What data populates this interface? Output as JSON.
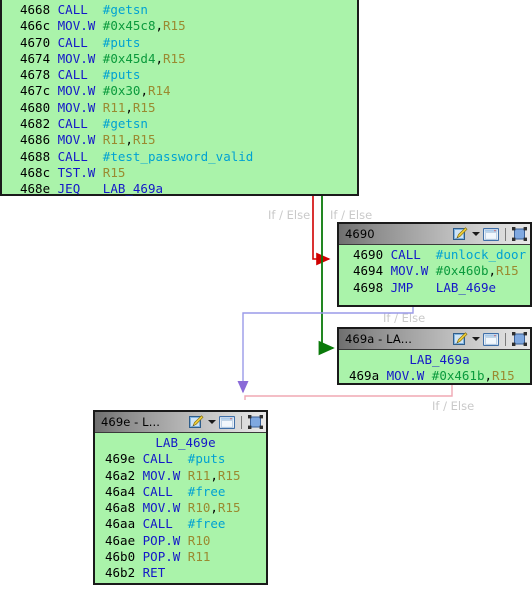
{
  "app": {
    "view": "function-graph",
    "background": "#ffffff"
  },
  "colors": {
    "block_body": "#aaf3aa",
    "block_border": "#1a1a1a",
    "mnemonic": "#1418c8",
    "register": "#9a8a30",
    "constant": "#0a9a3c",
    "symbol": "#00a2d2",
    "edge_true": "#008000",
    "edge_false": "#d00000",
    "edge_unconditional": "#9a9ae8",
    "edge_fallthrough_pink": "#f0a8b4",
    "edge_label_text": "#c9c9c9"
  },
  "blocks": [
    {
      "id": "entry",
      "title": null,
      "has_titlebar": false,
      "listing": [
        {
          "addr": "4668",
          "mnem": "CALL",
          "ops": [
            {
              "t": "sym",
              "v": "#getsn"
            }
          ]
        },
        {
          "addr": "466c",
          "mnem": "MOV.W",
          "ops": [
            {
              "t": "const",
              "v": "#0x45c8"
            },
            {
              "t": "punct",
              "v": ","
            },
            {
              "t": "reg",
              "v": "R15"
            }
          ]
        },
        {
          "addr": "4670",
          "mnem": "CALL",
          "ops": [
            {
              "t": "sym",
              "v": "#puts"
            }
          ]
        },
        {
          "addr": "4674",
          "mnem": "MOV.W",
          "ops": [
            {
              "t": "const",
              "v": "#0x45d4"
            },
            {
              "t": "punct",
              "v": ","
            },
            {
              "t": "reg",
              "v": "R15"
            }
          ]
        },
        {
          "addr": "4678",
          "mnem": "CALL",
          "ops": [
            {
              "t": "sym",
              "v": "#puts"
            }
          ]
        },
        {
          "addr": "467c",
          "mnem": "MOV.W",
          "ops": [
            {
              "t": "const",
              "v": "#0x30"
            },
            {
              "t": "punct",
              "v": ","
            },
            {
              "t": "reg",
              "v": "R14"
            }
          ]
        },
        {
          "addr": "4680",
          "mnem": "MOV.W",
          "ops": [
            {
              "t": "reg",
              "v": "R11"
            },
            {
              "t": "punct",
              "v": ","
            },
            {
              "t": "reg",
              "v": "R15"
            }
          ]
        },
        {
          "addr": "4682",
          "mnem": "CALL",
          "ops": [
            {
              "t": "sym",
              "v": "#getsn"
            }
          ]
        },
        {
          "addr": "4686",
          "mnem": "MOV.W",
          "ops": [
            {
              "t": "reg",
              "v": "R11"
            },
            {
              "t": "punct",
              "v": ","
            },
            {
              "t": "reg",
              "v": "R15"
            }
          ]
        },
        {
          "addr": "4688",
          "mnem": "CALL",
          "ops": [
            {
              "t": "sym",
              "v": "#test_password_valid"
            }
          ]
        },
        {
          "addr": "468c",
          "mnem": "TST.W",
          "ops": [
            {
              "t": "reg",
              "v": "R15"
            }
          ]
        },
        {
          "addr": "468e",
          "mnem": "JEQ",
          "ops": [
            {
              "t": "lbl",
              "v": "LAB_469a"
            }
          ]
        }
      ]
    },
    {
      "id": "b4690",
      "title": "4690",
      "has_titlebar": true,
      "listing": [
        {
          "addr": "4690",
          "mnem": "CALL",
          "ops": [
            {
              "t": "sym",
              "v": "#unlock_door"
            }
          ]
        },
        {
          "addr": "4694",
          "mnem": "MOV.W",
          "ops": [
            {
              "t": "const",
              "v": "#0x460b"
            },
            {
              "t": "punct",
              "v": ","
            },
            {
              "t": "reg",
              "v": "R15"
            }
          ]
        },
        {
          "addr": "4698",
          "mnem": "JMP",
          "ops": [
            {
              "t": "lbl",
              "v": "LAB_469e"
            }
          ]
        }
      ]
    },
    {
      "id": "b469a",
      "title": "469a - LA...",
      "has_titlebar": true,
      "label_line": "LAB_469a",
      "listing": [
        {
          "addr": "469a",
          "mnem": "MOV.W",
          "ops": [
            {
              "t": "const",
              "v": "#0x461b"
            },
            {
              "t": "punct",
              "v": ","
            },
            {
              "t": "reg",
              "v": "R15"
            }
          ]
        }
      ]
    },
    {
      "id": "b469e",
      "title": "469e - L...",
      "has_titlebar": true,
      "label_line": "LAB_469e",
      "listing": [
        {
          "addr": "469e",
          "mnem": "CALL",
          "ops": [
            {
              "t": "sym",
              "v": "#puts"
            }
          ]
        },
        {
          "addr": "46a2",
          "mnem": "MOV.W",
          "ops": [
            {
              "t": "reg",
              "v": "R11"
            },
            {
              "t": "punct",
              "v": ","
            },
            {
              "t": "reg",
              "v": "R15"
            }
          ]
        },
        {
          "addr": "46a4",
          "mnem": "CALL",
          "ops": [
            {
              "t": "sym",
              "v": "#free"
            }
          ]
        },
        {
          "addr": "46a8",
          "mnem": "MOV.W",
          "ops": [
            {
              "t": "reg",
              "v": "R10"
            },
            {
              "t": "punct",
              "v": ","
            },
            {
              "t": "reg",
              "v": "R15"
            }
          ]
        },
        {
          "addr": "46aa",
          "mnem": "CALL",
          "ops": [
            {
              "t": "sym",
              "v": "#free"
            }
          ]
        },
        {
          "addr": "46ae",
          "mnem": "POP.W",
          "ops": [
            {
              "t": "reg",
              "v": "R10"
            }
          ]
        },
        {
          "addr": "46b0",
          "mnem": "POP.W",
          "ops": [
            {
              "t": "reg",
              "v": "R11"
            }
          ]
        },
        {
          "addr": "46b2",
          "mnem": "RET",
          "ops": []
        }
      ]
    }
  ],
  "edge_labels": [
    {
      "id": "lbl1",
      "text": "If / Else"
    },
    {
      "id": "lbl2",
      "text": "If / Else"
    },
    {
      "id": "lbl3",
      "text": "If / Else"
    },
    {
      "id": "lbl4",
      "text": "If / Else"
    }
  ],
  "titlebar_icons": [
    {
      "name": "edit-color-icon",
      "tooltip": "Set Block Color"
    },
    {
      "name": "chevron-down-icon",
      "tooltip": "Color menu"
    },
    {
      "name": "window-icon",
      "tooltip": "Show in Listing"
    },
    {
      "name": "fit-selection-icon",
      "tooltip": "Zoom to Block"
    }
  ]
}
